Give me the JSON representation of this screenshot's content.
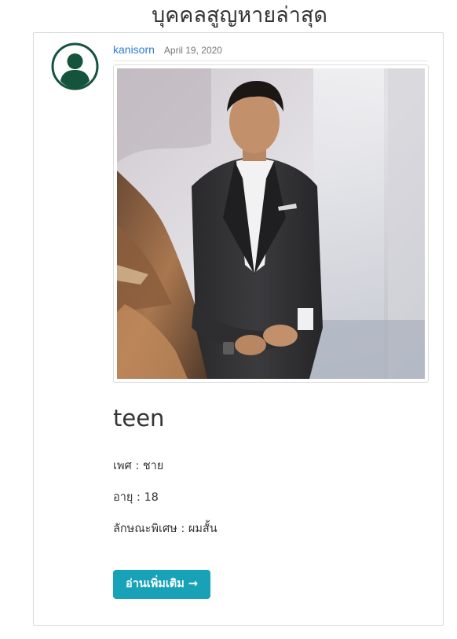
{
  "page": {
    "heading": "บุคคลสูญหายล่าสุด"
  },
  "post": {
    "author": "kanisorn",
    "date": "April 19, 2020",
    "title": "teen",
    "details": {
      "gender": "เพศ : ชาย",
      "age": "อายุ : 18",
      "feature": "ลักษณะพิเศษ : ผมสั้น"
    },
    "read_more_label": "อ่านเพิ่มเติม →"
  },
  "icons": {
    "avatar": "user-avatar-icon"
  },
  "colors": {
    "avatar": "#14543d",
    "author_link": "#2b7bd6",
    "button": "#17a2b8"
  }
}
